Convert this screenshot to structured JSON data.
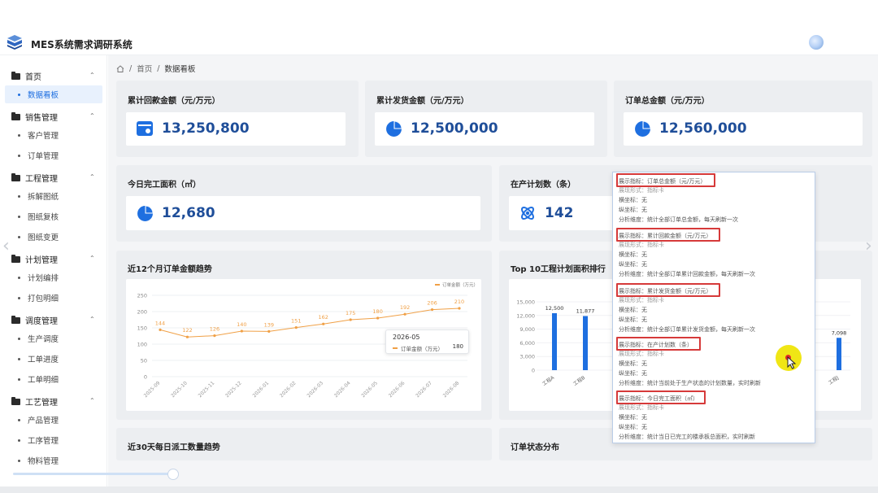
{
  "app": {
    "title": "MES系统需求调研系统"
  },
  "breadcrumb": {
    "items": [
      "首页",
      "数据看板"
    ],
    "sep": "/"
  },
  "sidebar": {
    "groups": [
      {
        "label": "首页",
        "items": [
          "数据看板"
        ]
      },
      {
        "label": "销售管理",
        "items": [
          "客户管理",
          "订单管理"
        ]
      },
      {
        "label": "工程管理",
        "items": [
          "拆解图纸",
          "图纸复核",
          "图纸变更"
        ]
      },
      {
        "label": "计划管理",
        "items": [
          "计划编排",
          "打包明细"
        ]
      },
      {
        "label": "调度管理",
        "items": [
          "生产调度",
          "工单进度",
          "工单明细"
        ]
      },
      {
        "label": "工艺管理",
        "items": [
          "产品管理",
          "工序管理",
          "物料管理"
        ]
      }
    ]
  },
  "kpi": {
    "payback": {
      "title": "累计回款金额（元/万元）",
      "value": "13,250,800"
    },
    "shipment": {
      "title": "累计发货金额（元/万元）",
      "value": "12,500,000"
    },
    "order_total": {
      "title": "订单总金额（元/万元）",
      "value": "12,560,000"
    },
    "done_area": {
      "title": "今日完工面积（㎡）",
      "value": "12,680"
    },
    "plans": {
      "title": "在产计划数（条）",
      "value": "142"
    }
  },
  "sections": {
    "trend_title": "近12个月订单金额趋势",
    "top10_title": "Top 10工程计划面积排行",
    "daily_title": "近30天每日派工数量趋势",
    "status_title": "订单状态分布"
  },
  "tooltip": {
    "date": "2026-05",
    "series": "订单金额（万元）",
    "value": "180"
  },
  "chart_data": [
    {
      "type": "line",
      "title": "近12个月订单金额趋势",
      "series": [
        {
          "name": "订单金额（万元）",
          "values": [
            144,
            122,
            126,
            140,
            139,
            151,
            162,
            175,
            180,
            192,
            206,
            210
          ]
        }
      ],
      "categories": [
        "2025-09",
        "2025-10",
        "2025-11",
        "2025-12",
        "2026-01",
        "2026-02",
        "2026-03",
        "2026-04",
        "2026-05",
        "2026-06",
        "2026-07",
        "2026-08"
      ],
      "y_ticks": [
        "0",
        "50",
        "100",
        "150",
        "200",
        "250"
      ],
      "ylim": [
        0,
        250
      ],
      "color": "#f0a046"
    },
    {
      "type": "bar",
      "title": "Top 10工程计划面积排行",
      "bars": [
        {
          "label": "工程A",
          "value": 12500,
          "value_label": "12,500"
        },
        {
          "label": "工程B",
          "value": 11877,
          "value_label": "11,877"
        },
        {
          "label": "工程J",
          "value": 7098,
          "value_label": "7,098"
        }
      ],
      "y_ticks": [
        "0",
        "3,000",
        "6,000",
        "9,000",
        "12,000",
        "15,000"
      ],
      "ylim": [
        0,
        15000
      ],
      "color": "#1e6fe0"
    }
  ],
  "popup": {
    "entries": [
      {
        "indicator": "展示指标：订单总金额（元/万元）",
        "form": "展现形式：指标卡",
        "x": "横坐标：无",
        "y": "纵坐标：无",
        "dim": "分析维度：统计全部订单总金额，每天刷新一次"
      },
      {
        "indicator": "展示指标：累计回款金额（元/万元）",
        "form": "展现形式：指标卡",
        "x": "横坐标：无",
        "y": "纵坐标：无",
        "dim": "分析维度：统计全部订单累计回款金额，每天刷新一次"
      },
      {
        "indicator": "展示指标：累计发货金额（元/万元）",
        "form": "展现形式：指标卡",
        "x": "横坐标：无",
        "y": "纵坐标：无",
        "dim": "分析维度：统计全部订单累计发货金额，每天刷新一次"
      },
      {
        "indicator": "展示指标：在产计划数（条）",
        "form": "展现形式：指标卡",
        "x": "横坐标：无",
        "y": "纵坐标：无",
        "dim": "分析维度：统计当前处于生产状态的计划数量，实时刷新"
      },
      {
        "indicator": "展示指标：今日完工面积（㎡）",
        "form": "展现形式：指标卡",
        "x": "横坐标：无",
        "y": "纵坐标：无",
        "dim": "分析维度：统计当日已完工的楼承板总面积，实时刷新"
      }
    ]
  }
}
